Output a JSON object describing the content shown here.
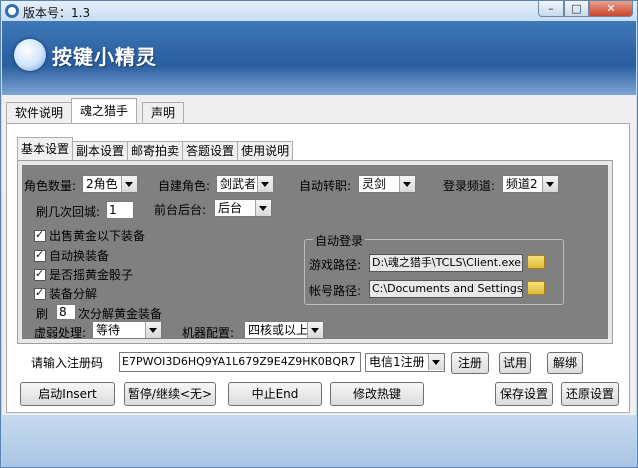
{
  "window": {
    "title": "版本号：1.3",
    "controls": {
      "minimize": "–",
      "maximize": "□",
      "close": "✕"
    }
  },
  "banner": {
    "logo_text": "按键小精灵"
  },
  "top_tabs": [
    "软件说明",
    "魂之猎手",
    "声明"
  ],
  "sub_tabs": [
    "基本设置",
    "副本设置",
    "邮寄拍卖",
    "答题设置",
    "使用说明"
  ],
  "settings": {
    "char_count_label": "角色数量:",
    "char_count_value": "2角色",
    "build_char_label": "自建角色:",
    "build_char_value": "剑武者",
    "auto_job_label": "自动转职:",
    "auto_job_value": "灵剑",
    "login_channel_label": "登录频道:",
    "login_channel_value": "频道2",
    "refresh_city_label": "刷几次回城:",
    "refresh_city_value": "1",
    "front_back_label": "前台后台:",
    "front_back_value": "后台",
    "checkboxes": [
      "出售黄金以下装备",
      "自动换装备",
      "是否摇黄金骰子",
      "装备分解"
    ],
    "refresh_prefix": "刷",
    "refresh_value": "8",
    "refresh_suffix": "次分解黄金装备",
    "weak_label": "虚弱处理:",
    "weak_value": "等待",
    "machine_label": "机器配置:",
    "machine_value": "四核或以上",
    "auto_login_title": "自动登录",
    "game_path_label": "游戏路径:",
    "game_path_value": "D:\\魂之猎手\\TCLS\\Client.exe",
    "account_path_label": "帐号路径:",
    "account_path_value": "C:\\Documents and Settings\\Adr"
  },
  "registration": {
    "label": "请输入注册码",
    "code": "E7PWOI3D6HQ9YA1L679Z9E4Z9HK0BQR7",
    "carrier": "电信1注册",
    "register_button": "注册",
    "trial_button": "试用",
    "unbind_button": "解绑"
  },
  "buttons": {
    "start": "启动Insert",
    "pause": "暂停/继续<无>",
    "stop": "中止End",
    "hotkey": "修改热键",
    "save": "保存设置",
    "restore": "还原设置"
  }
}
